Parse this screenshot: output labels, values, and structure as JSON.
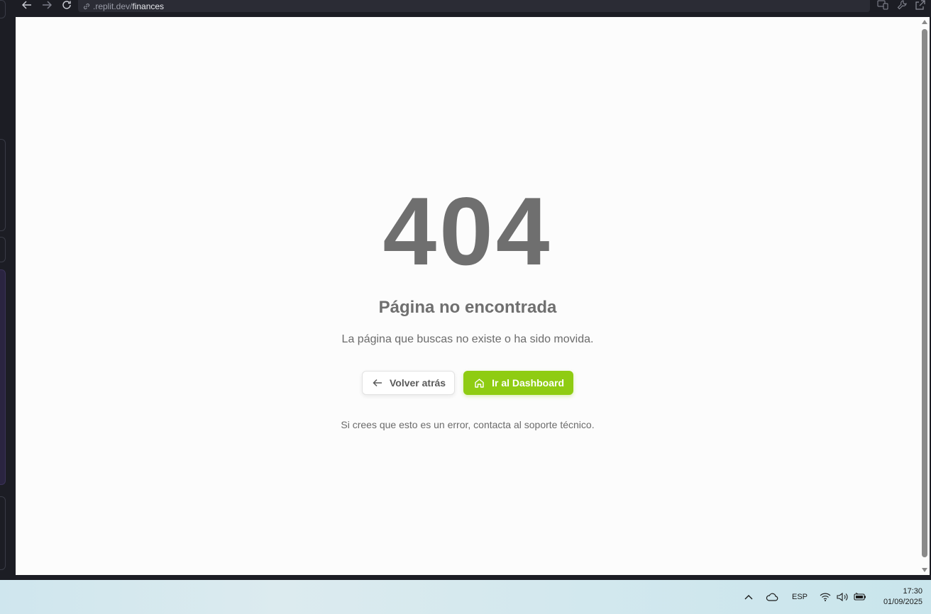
{
  "browser": {
    "url_domain": ".replit.dev/",
    "url_path": "finances"
  },
  "page": {
    "error_code": "404",
    "title": "Página no encontrada",
    "description": "La página que buscas no existe o ha sido movida.",
    "back_label": "Volver atrás",
    "dashboard_label": "Ir al Dashboard",
    "help_text": "Si crees que esto es un error, contacta al soporte técnico."
  },
  "taskbar": {
    "language": "ESP",
    "time": "17:30",
    "date": "01/09/2025"
  },
  "colors": {
    "accent": "#8fcc12",
    "text_muted": "#6f6f6f"
  }
}
